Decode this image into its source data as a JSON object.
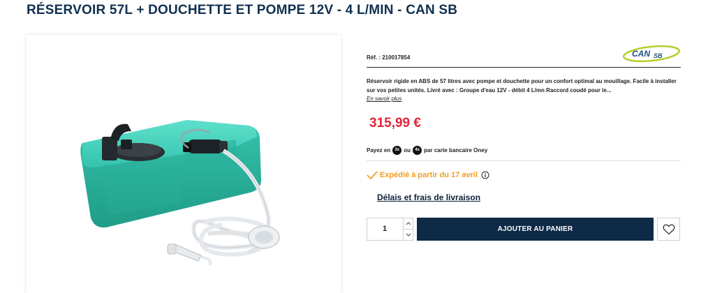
{
  "product": {
    "title": "RÉSERVOIR 57L + DOUCHETTE ET POMPE 12V - 4 L/MIN - CAN SB",
    "reference": "Réf. : 210017854",
    "brand_logo_text": "CANSB",
    "description": "Réservoir rigide en ABS de 57 litres avec pompe et douchette pour un confort optimal au mouillage. Facile à installer sur vos petites unités. Livré avec : Groupe d'eau 12V - débit 4 L/mn Raccord coudé pour le...",
    "read_more": "En savoir plus",
    "price": "315,99 €",
    "price_color": "#e4263b"
  },
  "payment": {
    "prefix": "Payez en",
    "option1": "3x",
    "connector": "ou",
    "option2": "4x",
    "suffix": "par carte bancaire Oney"
  },
  "shipping": {
    "text": "Expédié à partir du 17 avril",
    "color": "#f29b1f",
    "delivery_link": "Délais et frais de livraison"
  },
  "cart": {
    "quantity": "1",
    "add_label": "AJOUTER AU PANIER",
    "button_color": "#0f2a47"
  },
  "icons": {
    "ship": "check-icon",
    "info": "info-icon",
    "wishlist": "heart-icon",
    "qty_up": "chevron-up-icon",
    "qty_down": "chevron-down-icon"
  }
}
